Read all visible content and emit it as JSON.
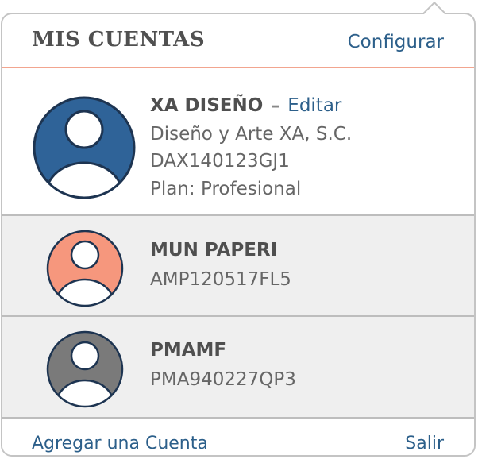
{
  "header": {
    "title": "MIS CUENTAS",
    "config_label": "Configurar"
  },
  "accounts": [
    {
      "name": "XA DISEÑO",
      "separator": "–",
      "edit_label": "Editar",
      "company": "Diseño y Arte XA, S.C.",
      "rfc": "DAX140123GJ1",
      "plan": "Plan: Profesional",
      "avatar_color": "#2f6398"
    },
    {
      "name": "MUN PAPERI",
      "rfc": "AMP120517FL5",
      "avatar_color": "#f6977d"
    },
    {
      "name": "PMAMF",
      "rfc": "PMA940227QP3",
      "avatar_color": "#7a7a7a"
    }
  ],
  "footer": {
    "add_label": "Agregar una Cuenta",
    "logout_label": "Salir"
  },
  "colors": {
    "link": "#2c5f8a",
    "divider_accent": "#f2a58f",
    "avatar_outline": "#1d3451"
  }
}
